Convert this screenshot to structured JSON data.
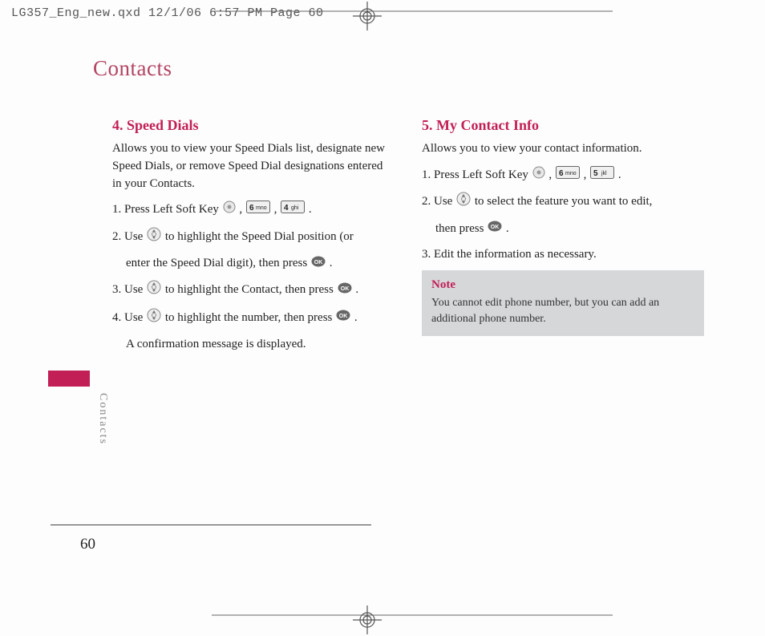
{
  "header_line": "LG357_Eng_new.qxd  12/1/06  6:57 PM  Page 60",
  "chapter_title": "Contacts",
  "side_label": "Contacts",
  "page_number": "60",
  "left": {
    "title": "4. Speed Dials",
    "intro": "Allows you to view your Speed Dials list, designate new Speed Dials, or remove Speed Dial designations entered in your Contacts.",
    "step1_a": "1. Press Left Soft Key ",
    "step1_b": " , ",
    "step1_c": " , ",
    "step1_d": " .",
    "step2_a": "2. Use ",
    "step2_b": " to highlight the Speed Dial position (or",
    "step2_c": "enter the Speed Dial digit), then press ",
    "step2_d": " .",
    "step3_a": "3. Use ",
    "step3_b": " to highlight the Contact, then press ",
    "step3_c": " .",
    "step4_a": "4. Use ",
    "step4_b": " to highlight the number, then press ",
    "step4_c": " .",
    "confirm": "A confirmation message is displayed."
  },
  "right": {
    "title": "5. My Contact Info",
    "intro": "Allows you to view your contact information.",
    "step1_a": "1. Press Left Soft Key ",
    "step1_b": " , ",
    "step1_c": " , ",
    "step1_d": " .",
    "step2_a": "2. Use ",
    "step2_b": " to select the feature you want to edit,",
    "step2_c": "then press ",
    "step2_d": " .",
    "step3": "3. Edit the information as necessary.",
    "note_title": "Note",
    "note_text": "You cannot edit phone number, but you can add an additional phone number."
  },
  "keys": {
    "four": "4 ghi",
    "five": "5 jkl",
    "six": "6mno"
  }
}
